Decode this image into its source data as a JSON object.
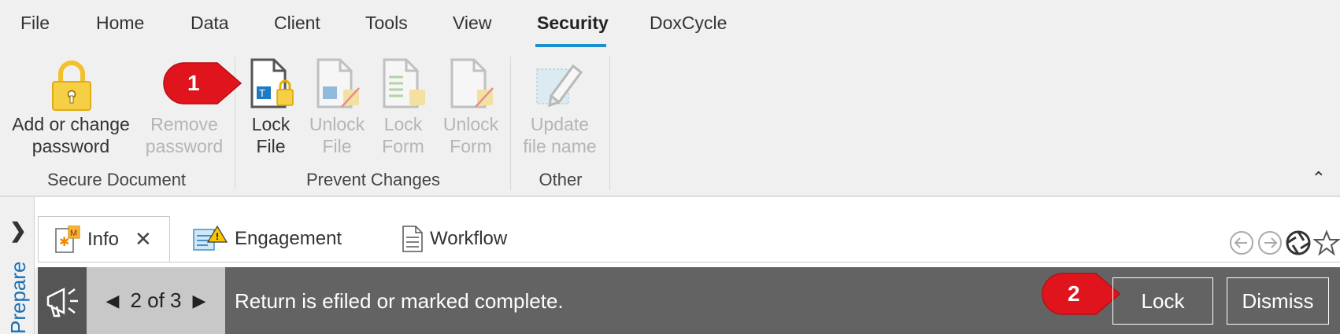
{
  "ribbon_tabs": [
    "File",
    "Home",
    "Data",
    "Client",
    "Tools",
    "View",
    "Security",
    "DoxCycle"
  ],
  "active_tab": "Security",
  "groups": {
    "secure_document": {
      "label": "Secure Document",
      "add_password": [
        "Add or change",
        "password"
      ],
      "remove_password": [
        "Remove",
        "password"
      ]
    },
    "prevent_changes": {
      "label": "Prevent Changes",
      "lock_file": [
        "Lock",
        "File"
      ],
      "unlock_file": [
        "Unlock",
        "File"
      ],
      "lock_form": [
        "Lock",
        "Form"
      ],
      "unlock_form": [
        "Unlock",
        "Form"
      ]
    },
    "other": {
      "label": "Other",
      "update_file_name": [
        "Update",
        "file name"
      ]
    }
  },
  "badges": {
    "step1": "1",
    "step2": "2"
  },
  "side_label": "Prepare",
  "doc_tabs": {
    "info": "Info",
    "engagement": "Engagement",
    "workflow": "Workflow"
  },
  "notification": {
    "pager": "2 of 3",
    "message": "Return is efiled or marked complete.",
    "lock": "Lock",
    "dismiss": "Dismiss"
  },
  "colors": {
    "accent": "#1b8fd0",
    "badge_red": "#e0141c",
    "notification_bg": "#636363",
    "lock_gold": "#f2c12e"
  },
  "icons": [
    "padlock-icon",
    "lock-file-icon",
    "unlock-file-icon",
    "lock-form-icon",
    "unlock-form-icon",
    "pencil-icon",
    "chevron-up-icon",
    "chevron-right-icon",
    "megaphone-icon",
    "back-circle-icon",
    "forward-circle-icon",
    "aperture-icon",
    "star-icon"
  ]
}
